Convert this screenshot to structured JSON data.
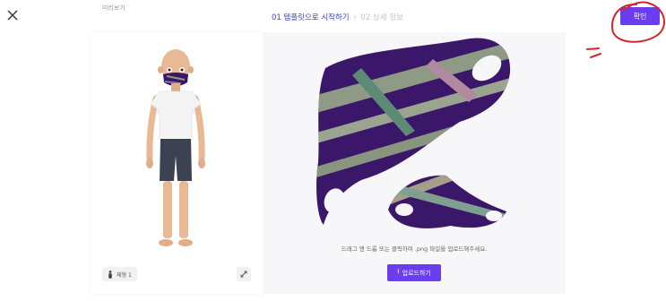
{
  "header": {
    "preview_label": "미리보기",
    "steps": [
      {
        "label": "01 템플릿으로 시작하기"
      },
      {
        "label": "02 상세 정보"
      }
    ],
    "step_separator": "›",
    "confirm_label": "확인"
  },
  "preview": {
    "body_type_label": "체형 1"
  },
  "template": {
    "hint": "드래그 앤 드롭 또는 클릭하여 .png 파일을 업로드해주세요.",
    "upload_label": "업로드하기",
    "upload_icon": "⭱"
  },
  "colors": {
    "accent": "#6b3df0",
    "active_step": "#3d3dcf",
    "annotation": "#d0262e",
    "mask_dark": "#3b1769"
  }
}
